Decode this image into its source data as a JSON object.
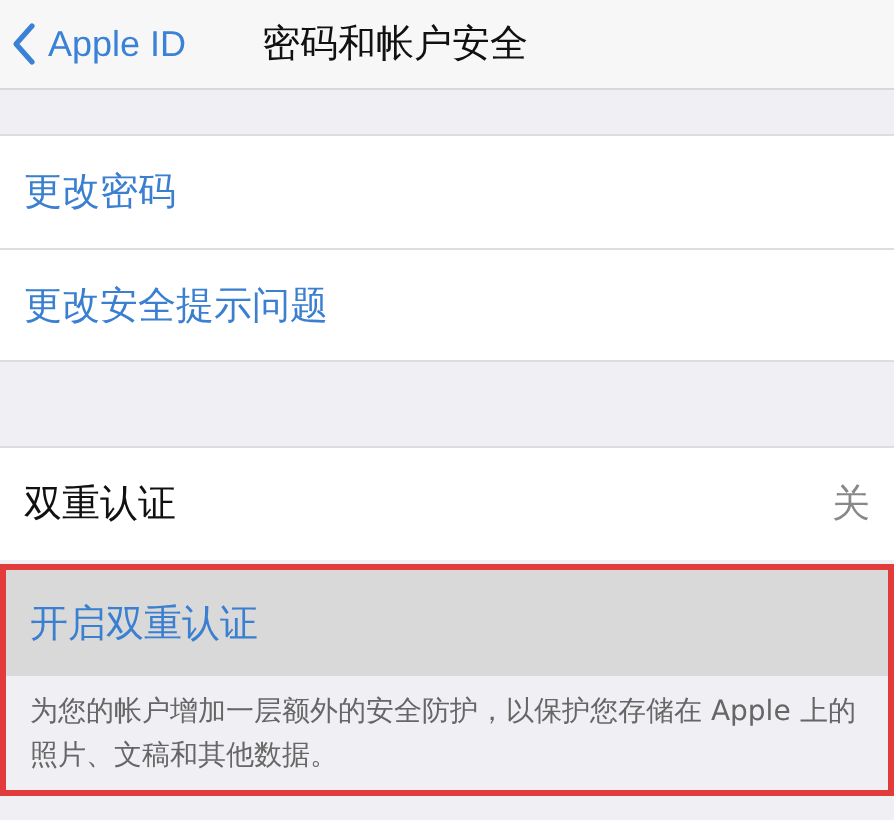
{
  "nav_bar": {
    "back_label": "Apple ID",
    "title": "密码和帐户安全"
  },
  "password_group": {
    "items": [
      {
        "label": "更改密码"
      },
      {
        "label": "更改安全提示问题"
      }
    ]
  },
  "two_factor_group": {
    "status_row": {
      "label": "双重认证",
      "value": "关"
    },
    "action_row": {
      "label": "开启双重认证",
      "selected": true
    },
    "footer": "为您的帐户增加一层额外的安全防护，以保护您存储在 Apple 上的照片、文稿和其他数据。",
    "outlined": true
  }
}
